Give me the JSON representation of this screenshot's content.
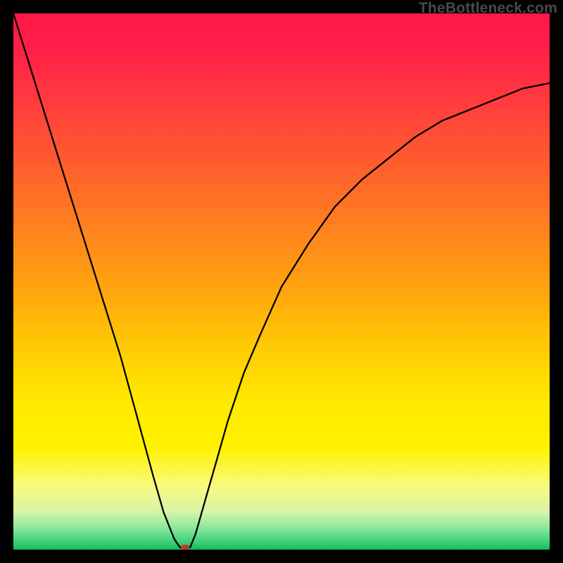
{
  "watermark": "TheBottleneck.com",
  "colors": {
    "frame": "#000000",
    "curve": "#000000",
    "marker": "#c0392b",
    "grad_top": "#ff1744",
    "grad_bottom": "#14b85b"
  },
  "chart_data": {
    "type": "line",
    "title": "",
    "xlabel": "",
    "ylabel": "",
    "xlim": [
      0,
      100
    ],
    "ylim": [
      0,
      100
    ],
    "series": [
      {
        "name": "bottleneck-curve",
        "x": [
          0,
          5,
          10,
          15,
          20,
          23,
          26,
          28,
          30,
          31,
          32,
          33,
          34,
          36,
          38,
          40,
          43,
          46,
          50,
          55,
          60,
          65,
          70,
          75,
          80,
          85,
          90,
          95,
          100
        ],
        "y": [
          100,
          84,
          68,
          52,
          36,
          25,
          14,
          7,
          2,
          0.5,
          0,
          0.5,
          3,
          10,
          17,
          24,
          33,
          40,
          49,
          57,
          64,
          69,
          73,
          77,
          80,
          82,
          84,
          86,
          87
        ]
      }
    ],
    "marker": {
      "x": 32,
      "y": 0
    },
    "gradient_stops": [
      {
        "pos": 0,
        "color": "#ff1744"
      },
      {
        "pos": 50,
        "color": "#ffa010"
      },
      {
        "pos": 75,
        "color": "#ffe800"
      },
      {
        "pos": 100,
        "color": "#14b85b"
      }
    ]
  }
}
